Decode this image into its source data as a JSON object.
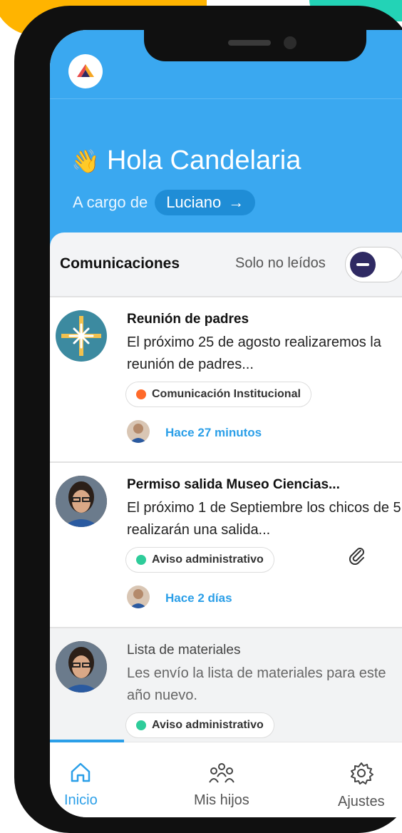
{
  "header": {
    "greeting_emoji": "👋",
    "greeting": "Hola Candelaria",
    "in_charge_label": "A cargo de",
    "child_name": "Luciano",
    "child_arrow": "→"
  },
  "communications": {
    "title": "Comunicaciones",
    "unread_only_label": "Solo no leídos"
  },
  "messages": [
    {
      "title": "Reunión de padres",
      "body": "El próximo 25 de agosto realizaremos la reunión de padres...",
      "tag": "Comunicación Institucional",
      "tag_color": "#ff6a2a",
      "time": "Hace 27 minutos"
    },
    {
      "title": "Permiso salida Museo Ciencias...",
      "body": "El próximo 1 de Septiembre los chicos de 5 realizarán una salida...",
      "tag": "Aviso administrativo",
      "tag_color": "#2ecc9a",
      "time": "Hace 2 días",
      "attachment_icon": "paperclip-icon"
    },
    {
      "title": "Lista de materiales",
      "body": "Les envío la lista de materiales para este año nuevo.",
      "tag": "Aviso administrativo",
      "tag_color": "#2ecc9a"
    }
  ],
  "nav": {
    "items": [
      {
        "label": "Inicio",
        "icon": "home-icon"
      },
      {
        "label": "Mis hijos",
        "icon": "people-icon"
      },
      {
        "label": "Ajustes",
        "icon": "gear-icon"
      }
    ]
  },
  "colors": {
    "primary": "#3aa8f0",
    "accent": "#2b9fe8",
    "toggle": "#2f2a63"
  }
}
